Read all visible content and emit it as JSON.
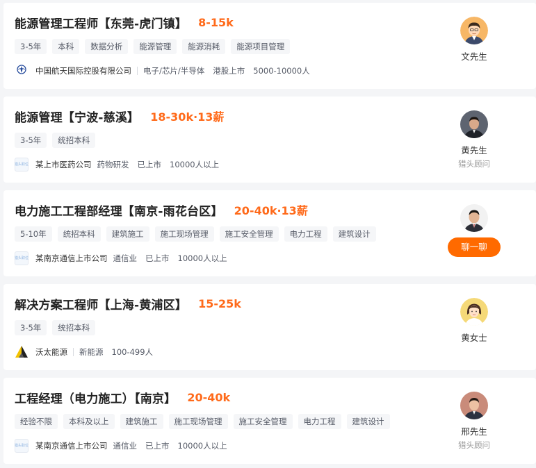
{
  "jobs": [
    {
      "title": "能源管理工程师【东莞-虎门镇】",
      "salary": "8-15k",
      "tags": [
        "3-5年",
        "本科",
        "数据分析",
        "能源管理",
        "能源消耗",
        "能源项目管理"
      ],
      "company": "中国航天国际控股有限公司",
      "logo_text": "中国航天",
      "industry": "电子/芯片/半导体",
      "listing": "港股上市",
      "size": "5000-10000人",
      "recruiter": {
        "name": "文先生",
        "role": "",
        "avatar": "cartoon-man-avatar"
      }
    },
    {
      "title": "能源管理【宁波-慈溪】",
      "salary": "18-30k·13薪",
      "tags": [
        "3-5年",
        "统招本科"
      ],
      "company": "某上市医药公司",
      "logo_text": "猎头职位",
      "industry": "药物研发",
      "listing": "已上市",
      "size": "10000人以上",
      "recruiter": {
        "name": "黄先生",
        "role": "猎头顾问",
        "avatar": "man-photo-avatar"
      }
    },
    {
      "title": "电力施工工程部经理【南京-雨花台区】",
      "salary": "20-40k·13薪",
      "tags": [
        "5-10年",
        "统招本科",
        "建筑施工",
        "施工现场管理",
        "施工安全管理",
        "电力工程",
        "建筑设计"
      ],
      "company": "某南京通信上市公司",
      "logo_text": "猎头职位",
      "industry": "通信业",
      "listing": "已上市",
      "size": "10000人以上",
      "recruiter": {
        "name": "",
        "role": "",
        "avatar": "man-photo-avatar",
        "chat_label": "聊一聊"
      }
    },
    {
      "title": "解决方案工程师【上海-黄浦区】",
      "salary": "15-25k",
      "tags": [
        "3-5年",
        "统招本科"
      ],
      "company": "沃太能源",
      "logo_text": "",
      "industry": "新能源",
      "listing": "",
      "size": "100-499人",
      "recruiter": {
        "name": "黄女士",
        "role": "",
        "avatar": "cartoon-woman-avatar"
      }
    },
    {
      "title": "工程经理（电力施工）【南京】",
      "salary": "20-40k",
      "tags": [
        "经验不限",
        "本科及以上",
        "建筑施工",
        "施工现场管理",
        "施工安全管理",
        "电力工程",
        "建筑设计"
      ],
      "company": "某南京通信上市公司",
      "logo_text": "猎头职位",
      "industry": "通信业",
      "listing": "已上市",
      "size": "10000人以上",
      "recruiter": {
        "name": "邢先生",
        "role": "猎头顾问",
        "avatar": "man-photo-avatar"
      }
    }
  ],
  "colors": {
    "salary": "#ff6a1a",
    "chat_button": "#ff6a00",
    "tag_bg": "#f5f6f8",
    "page_bg": "#f4f5f7"
  }
}
